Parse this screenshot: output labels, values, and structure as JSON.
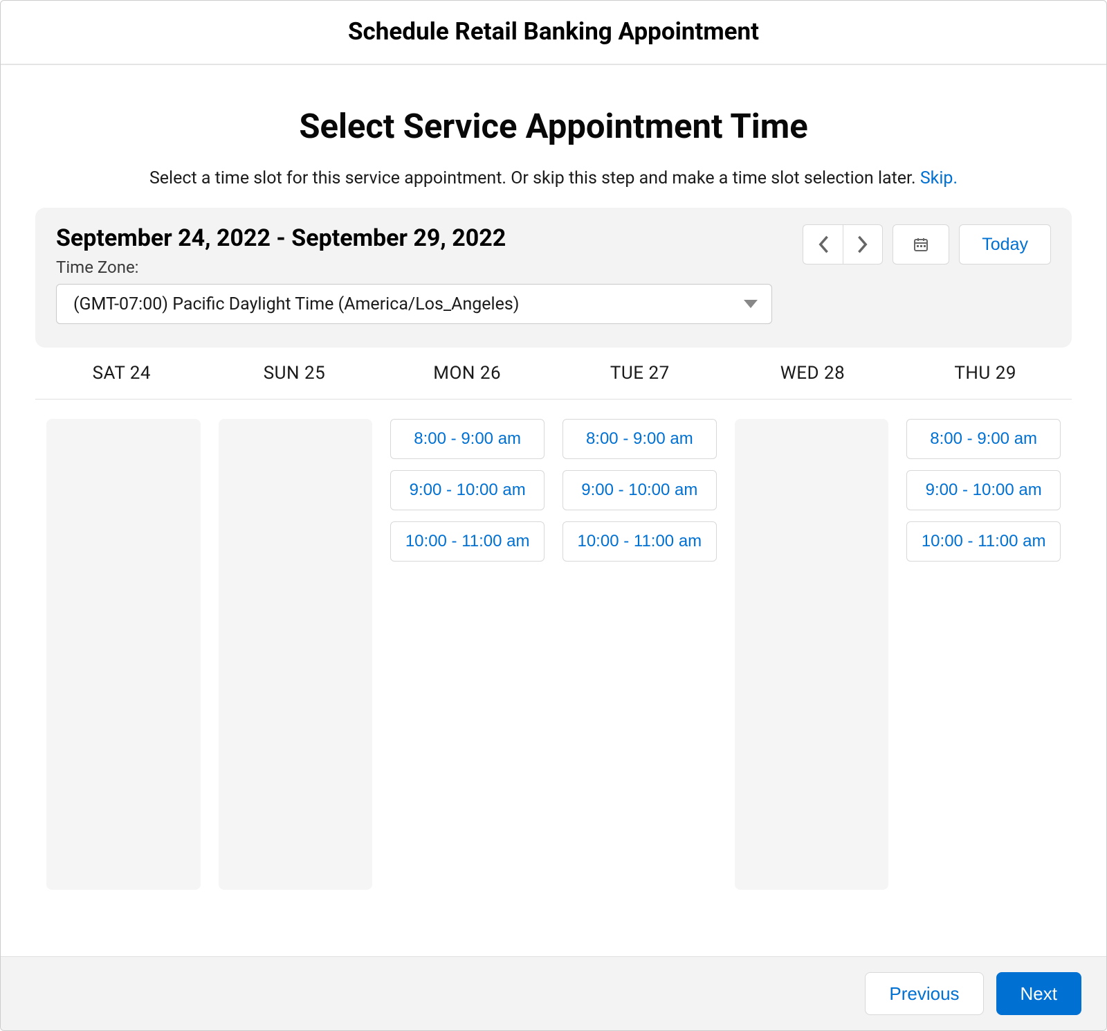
{
  "header": {
    "title": "Schedule Retail Banking Appointment"
  },
  "main": {
    "heading": "Select Service Appointment Time",
    "subtitle_prefix": "Select a time slot for this service appointment. Or skip this step and make a time slot selection later. ",
    "skip_label": "Skip."
  },
  "toolbar": {
    "date_range": "September 24, 2022 - September 29, 2022",
    "tz_label": "Time Zone:",
    "tz_value": "(GMT-07:00) Pacific Daylight Time (America/Los_Angeles)",
    "today_label": "Today"
  },
  "days": [
    {
      "label": "SAT 24",
      "available": false,
      "slots": []
    },
    {
      "label": "SUN 25",
      "available": false,
      "slots": []
    },
    {
      "label": "MON 26",
      "available": true,
      "slots": [
        "8:00 - 9:00 am",
        "9:00 - 10:00 am",
        "10:00 - 11:00 am"
      ]
    },
    {
      "label": "TUE 27",
      "available": true,
      "slots": [
        "8:00 - 9:00 am",
        "9:00 - 10:00 am",
        "10:00 - 11:00 am"
      ]
    },
    {
      "label": "WED 28",
      "available": false,
      "slots": []
    },
    {
      "label": "THU 29",
      "available": true,
      "slots": [
        "8:00 - 9:00 am",
        "9:00 - 10:00 am",
        "10:00 - 11:00 am"
      ]
    }
  ],
  "footer": {
    "previous_label": "Previous",
    "next_label": "Next"
  }
}
